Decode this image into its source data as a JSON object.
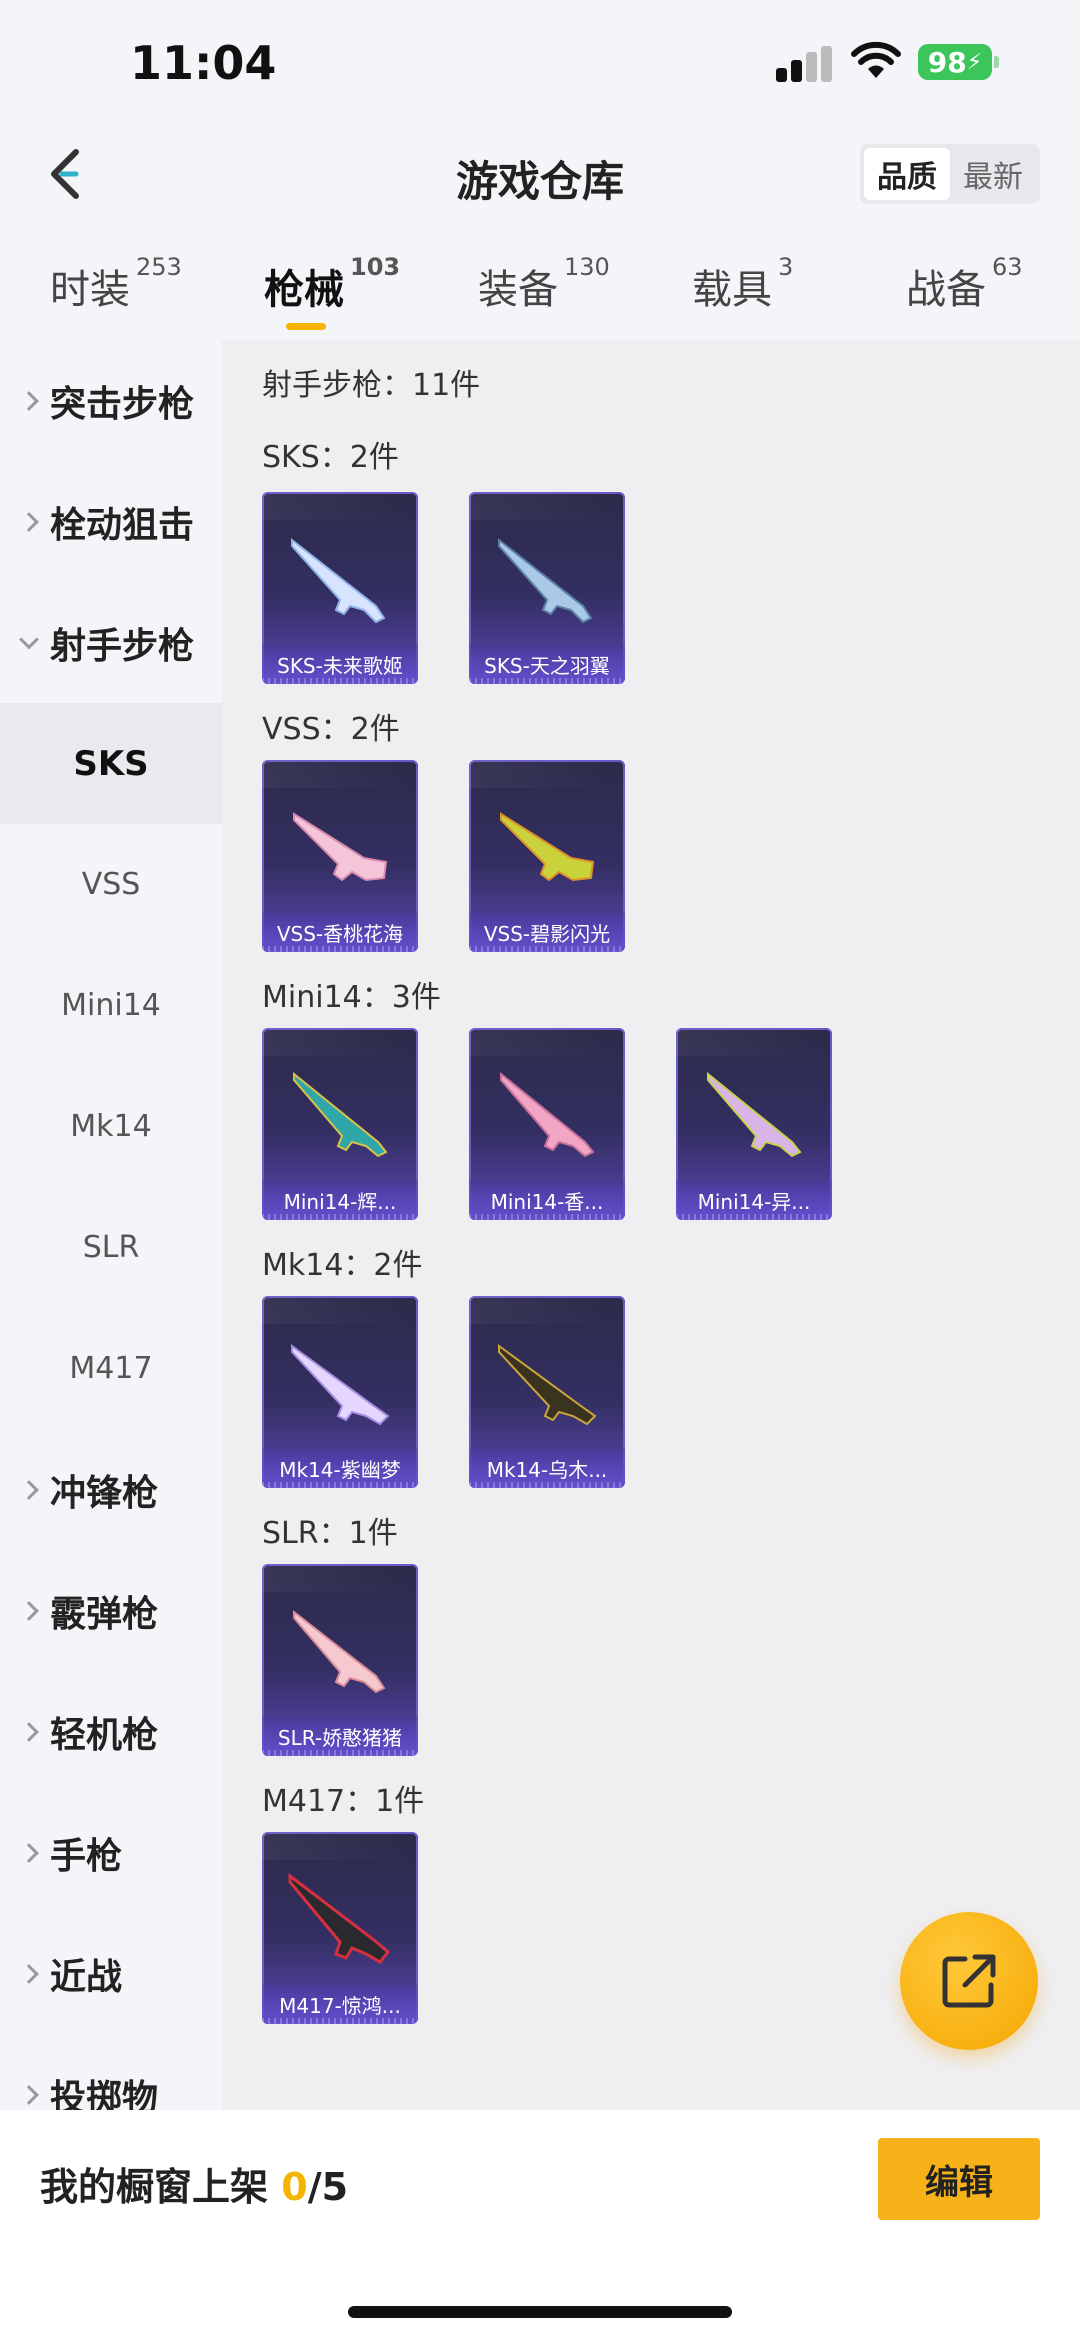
{
  "status_bar": {
    "time": "11:04",
    "battery": "98"
  },
  "header": {
    "title": "游戏仓库",
    "sort_options": [
      "品质",
      "最新"
    ],
    "sort_selected": "品质"
  },
  "tabs": [
    {
      "label": "时装",
      "count": "253"
    },
    {
      "label": "枪械",
      "count": "103",
      "active": true
    },
    {
      "label": "装备",
      "count": "130"
    },
    {
      "label": "载具",
      "count": "3"
    },
    {
      "label": "战备",
      "count": "63"
    }
  ],
  "sidebar": {
    "groups_top": [
      "突击步枪",
      "栓动狙击",
      "射手步枪"
    ],
    "subitems": [
      "SKS",
      "VSS",
      "Mini14",
      "Mk14",
      "SLR",
      "M417"
    ],
    "groups_bottom": [
      "冲锋枪",
      "霰弹枪",
      "轻机枪",
      "手枪",
      "近战",
      "投掷物"
    ]
  },
  "content": {
    "category_summary": "射手步枪：11件",
    "sections": [
      {
        "title": "SKS：2件",
        "items": [
          "SKS-未来歌姬",
          "SKS-天之羽翼"
        ]
      },
      {
        "title": "VSS：2件",
        "items": [
          "VSS-香桃花海",
          "VSS-碧影闪光"
        ]
      },
      {
        "title": "Mini14：3件",
        "items": [
          "Mini14-辉...",
          "Mini14-香...",
          "Mini14-异..."
        ]
      },
      {
        "title": "Mk14：2件",
        "items": [
          "Mk14-紫幽梦",
          "Mk14-乌木..."
        ]
      },
      {
        "title": "SLR：1件",
        "items": [
          "SLR-娇憨猪猪"
        ]
      },
      {
        "title": "M417：1件",
        "items": [
          "M417-惊鸿..."
        ]
      }
    ]
  },
  "bottom_bar": {
    "shelf_label": "我的橱窗上架 ",
    "shelf_current": "0",
    "shelf_total": "/5",
    "edit_label": "编辑"
  },
  "colors": {
    "accent": "#f5b400",
    "card_purple": "#5a46b3"
  },
  "icons": {
    "back": "back-chevron-icon",
    "share": "share-external-icon"
  }
}
